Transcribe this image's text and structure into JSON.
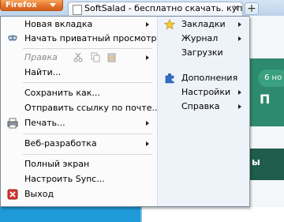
{
  "browser": {
    "app_button": "Firefox",
    "tab_title": "SoftSalad - бесплатно скачать. купить",
    "new_tab_symbol": "+",
    "tab_close_symbol": "×"
  },
  "page_fragments": {
    "pill_text": "6 но",
    "big_text": "П",
    "dark_text": "ы"
  },
  "menu": {
    "left": {
      "new_tab": "Новая вкладка",
      "private": "Начать приватный просмотр",
      "edit": "Правка",
      "find": "Найти...",
      "save_as": "Сохранить как...",
      "send_link": "Отправить ссылку по почте...",
      "print": "Печать...",
      "web_dev": "Веб-разработка",
      "fullscreen": "Полный экран",
      "sync": "Настроить Sync...",
      "exit": "Выход"
    },
    "right": {
      "bookmarks": "Закладки",
      "history": "Журнал",
      "downloads": "Загрузки",
      "addons": "Дополнения",
      "settings": "Настройки",
      "help": "Справка"
    }
  },
  "icons": {
    "private": "mask-icon",
    "cut": "scissors-icon",
    "copy": "copy-icon",
    "paste": "paste-icon",
    "print": "printer-icon",
    "exit": "exit-icon",
    "bookmarks": "star-icon",
    "addons": "puzzle-icon"
  },
  "colors": {
    "firefox_orange": "#e3702a",
    "menu_bg": "#fbfbfb",
    "right_col_bg": "#eef3fa"
  }
}
